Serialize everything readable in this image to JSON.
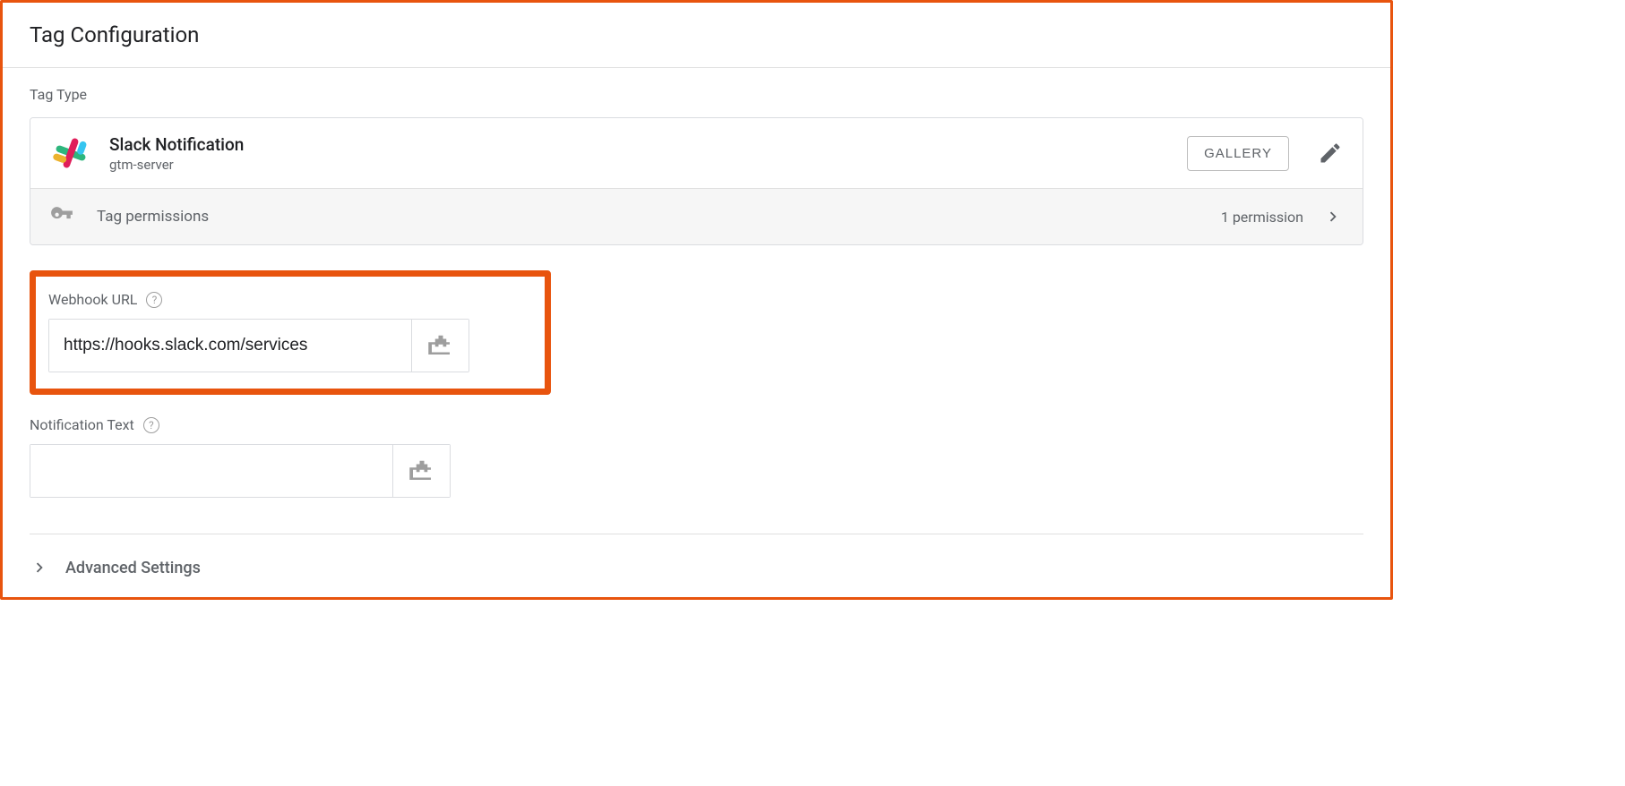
{
  "header": {
    "title": "Tag Configuration"
  },
  "tagType": {
    "sectionLabel": "Tag Type",
    "name": "Slack Notification",
    "provider": "gtm-server",
    "galleryLabel": "GALLERY"
  },
  "permissions": {
    "label": "Tag permissions",
    "count": "1 permission"
  },
  "fields": {
    "webhook": {
      "label": "Webhook URL",
      "value": "https://hooks.slack.com/services"
    },
    "notification": {
      "label": "Notification Text",
      "value": ""
    }
  },
  "advanced": {
    "label": "Advanced Settings"
  }
}
